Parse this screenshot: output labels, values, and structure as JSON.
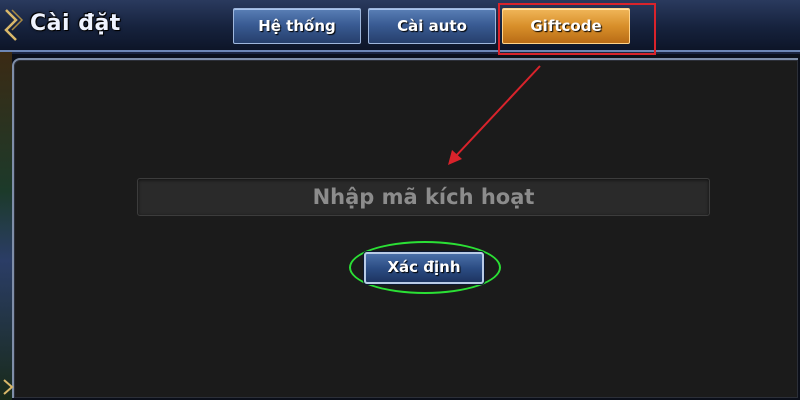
{
  "header": {
    "title": "Cài đặt"
  },
  "tabs": [
    {
      "label": "Hệ thống",
      "active": false
    },
    {
      "label": "Cài auto",
      "active": false
    },
    {
      "label": "Giftcode",
      "active": true
    }
  ],
  "giftcode": {
    "input_value": "",
    "input_placeholder": "Nhập mã kích hoạt",
    "confirm_label": "Xác định"
  },
  "annotations": {
    "highlight_color": "#d9232b",
    "ellipse_color": "#2be035"
  },
  "colors": {
    "tab_inactive": "#3a5c94",
    "tab_active": "#d88f2a",
    "panel_bg": "#1b1b1b"
  }
}
